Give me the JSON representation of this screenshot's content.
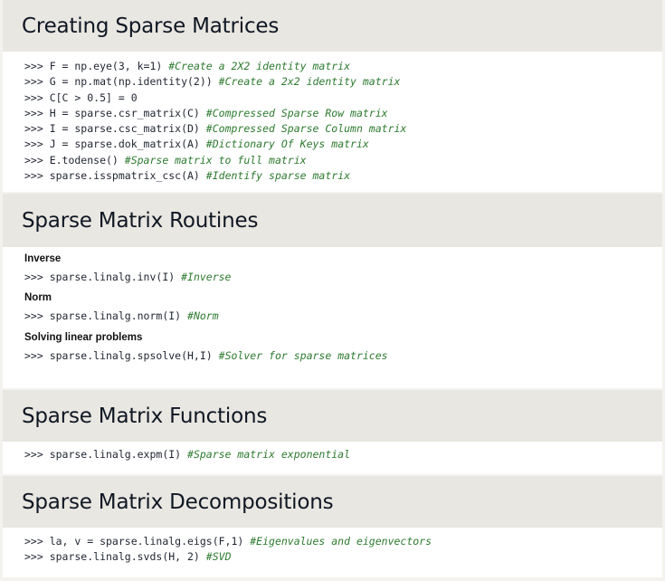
{
  "sections": [
    {
      "title": "Creating Sparse Matrices",
      "lines": [
        {
          "code": ">>> F = np.eye(3, k=1) ",
          "comment": "#Create a 2X2 identity matrix"
        },
        {
          "code": ">>> G = np.mat(np.identity(2)) ",
          "comment": "#Create a 2x2 identity matrix"
        },
        {
          "code": ">>> C[C > 0.5] = 0",
          "comment": ""
        },
        {
          "code": ">>> H = sparse.csr_matrix(C) ",
          "comment": "#Compressed Sparse Row matrix"
        },
        {
          "code": ">>> I = sparse.csc_matrix(D) ",
          "comment": "#Compressed Sparse Column matrix"
        },
        {
          "code": ">>> J = sparse.dok_matrix(A) ",
          "comment": "#Dictionary Of Keys matrix"
        },
        {
          "code": ">>> E.todense() ",
          "comment": "#Sparse matrix to full matrix"
        },
        {
          "code": ">>> sparse.isspmatrix_csc(A) ",
          "comment": "#Identify sparse matrix"
        }
      ]
    },
    {
      "title": "Sparse Matrix Routines",
      "groups": [
        {
          "label": "Inverse",
          "code": ">>> sparse.linalg.inv(I) ",
          "comment": "#Inverse"
        },
        {
          "label": "Norm",
          "code": ">>> sparse.linalg.norm(I) ",
          "comment": "#Norm"
        },
        {
          "label": "Solving linear problems",
          "code": ">>> sparse.linalg.spsolve(H,I) ",
          "comment": "#Solver for sparse matrices"
        }
      ]
    },
    {
      "title": "Sparse Matrix Functions",
      "lines": [
        {
          "code": ">>> sparse.linalg.expm(I) ",
          "comment": "#Sparse matrix exponential"
        }
      ]
    },
    {
      "title": "Sparse Matrix Decompositions",
      "lines": [
        {
          "code": ">>> la, v = sparse.linalg.eigs(F,1) ",
          "comment": "#Eigenvalues and eigenvectors"
        },
        {
          "code": ">>> sparse.linalg.svds(H, 2) ",
          "comment": "#SVD"
        }
      ]
    }
  ],
  "colors": {
    "header_bg": "#e9e7e1",
    "body_bg": "#ffffff",
    "comment": "#2d7a2f",
    "title": "#0f1724"
  }
}
